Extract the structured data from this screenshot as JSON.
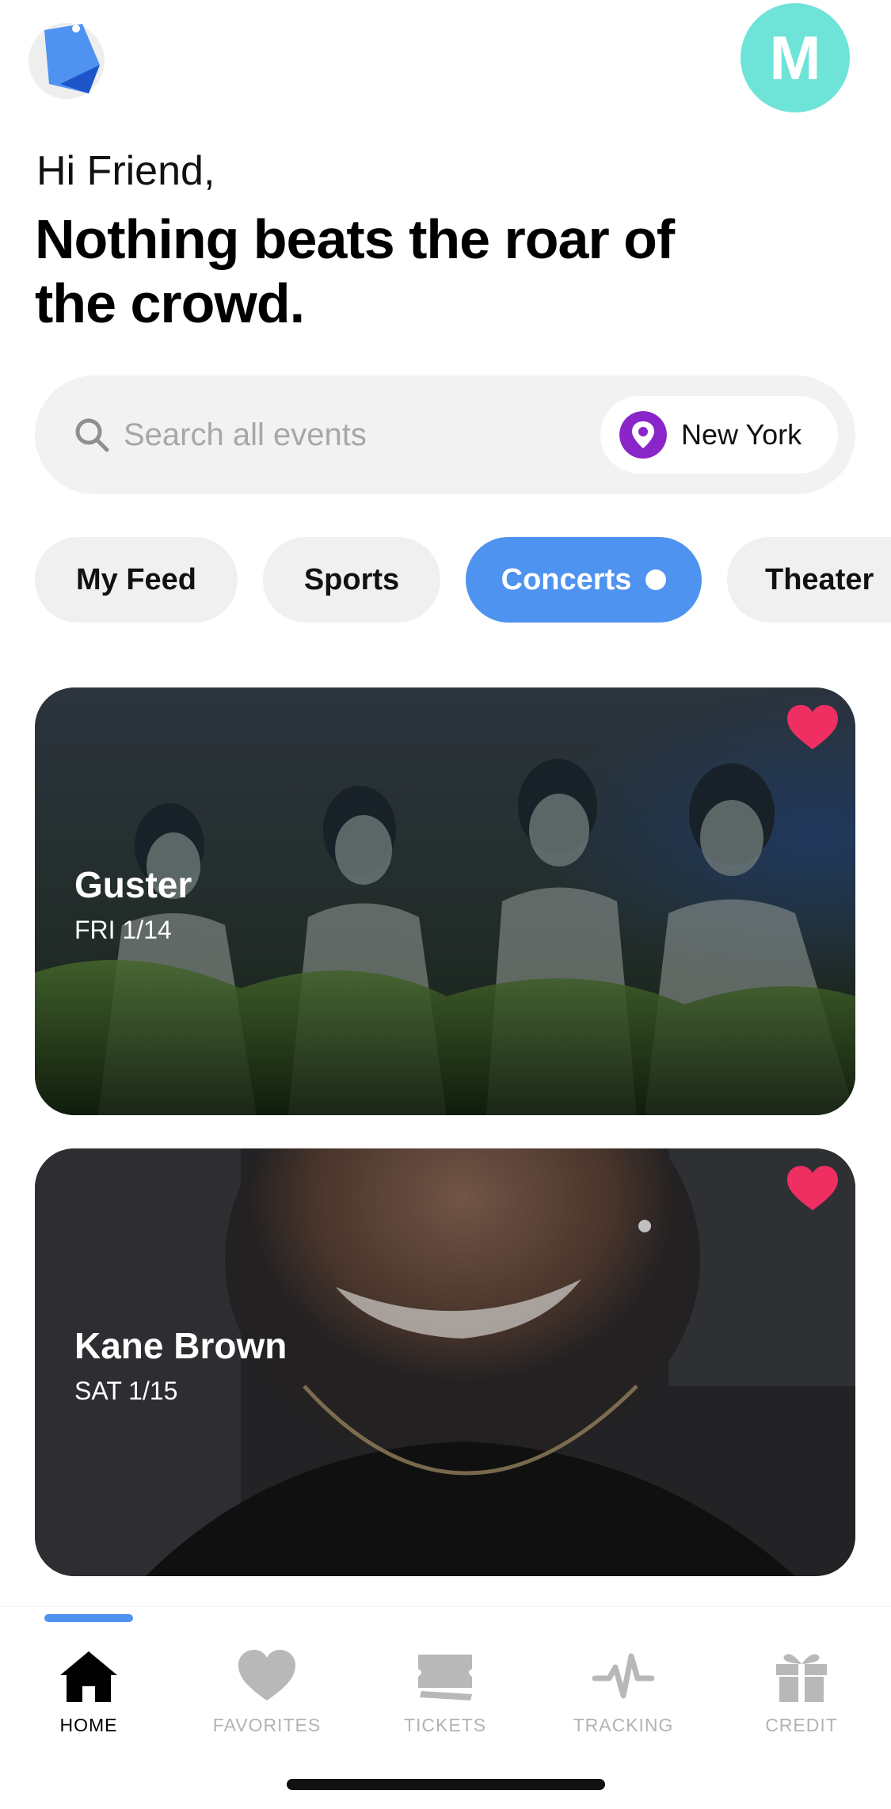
{
  "colors": {
    "accent": "#4f93f0",
    "avatar_bg": "#6ee3d8",
    "heart": "#ef2f62",
    "pin": "#8a26c9",
    "chip_bg": "#f0f0f0"
  },
  "header": {
    "logo_icon": "app-logo-icon",
    "avatar_initial": "M"
  },
  "greeting": "Hi Friend,",
  "headline": "Nothing beats the roar of the crowd.",
  "search": {
    "placeholder": "Search all events",
    "location": "New York"
  },
  "categories": [
    {
      "label": "My Feed",
      "active": false
    },
    {
      "label": "Sports",
      "active": false
    },
    {
      "label": "Concerts",
      "active": true
    },
    {
      "label": "Theater",
      "active": false
    }
  ],
  "events": [
    {
      "title": "Guster",
      "date": "FRI 1/14",
      "favorited": true
    },
    {
      "title": "Kane Brown",
      "date": "SAT 1/15",
      "favorited": true
    }
  ],
  "tabbar": {
    "items": [
      {
        "label": "HOME",
        "icon": "home-icon",
        "active": true
      },
      {
        "label": "FAVORITES",
        "icon": "heart-icon",
        "active": false
      },
      {
        "label": "TICKETS",
        "icon": "ticket-icon",
        "active": false
      },
      {
        "label": "TRACKING",
        "icon": "pulse-icon",
        "active": false
      },
      {
        "label": "CREDIT",
        "icon": "gift-icon",
        "active": false
      }
    ]
  }
}
